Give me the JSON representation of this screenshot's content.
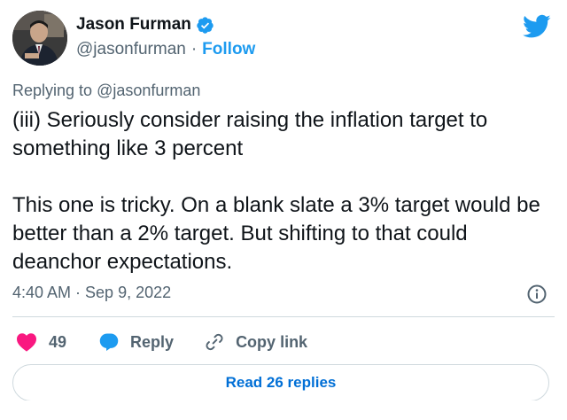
{
  "author": {
    "display_name": "Jason Furman",
    "handle": "@jasonfurman",
    "separator": "·",
    "follow_label": "Follow",
    "verified_icon": "verified-badge-icon",
    "avatar": "avatar"
  },
  "brand": {
    "logo_icon": "twitter-bird-icon",
    "accent": "#1d9bf0"
  },
  "reply_context": {
    "prefix": "Replying to",
    "mention": "@jasonfurman"
  },
  "tweet": {
    "paragraph1": "(iii) Seriously consider raising the inflation target to something like 3 percent",
    "paragraph2": "This one is tricky. On a blank slate a 3% target would be better than a 2% target. But shifting to that could deanchor expectations.",
    "timestamp": "4:40 AM · Sep 9, 2022"
  },
  "actions": {
    "like_count": "49",
    "like_icon": "heart-icon",
    "like_color": "#f91880",
    "reply_label": "Reply",
    "reply_icon": "speech-bubble-icon",
    "reply_color": "#1d9bf0",
    "copy_label": "Copy link",
    "copy_icon": "link-icon",
    "info_icon": "info-icon"
  },
  "read_replies": {
    "label": "Read 26 replies"
  }
}
